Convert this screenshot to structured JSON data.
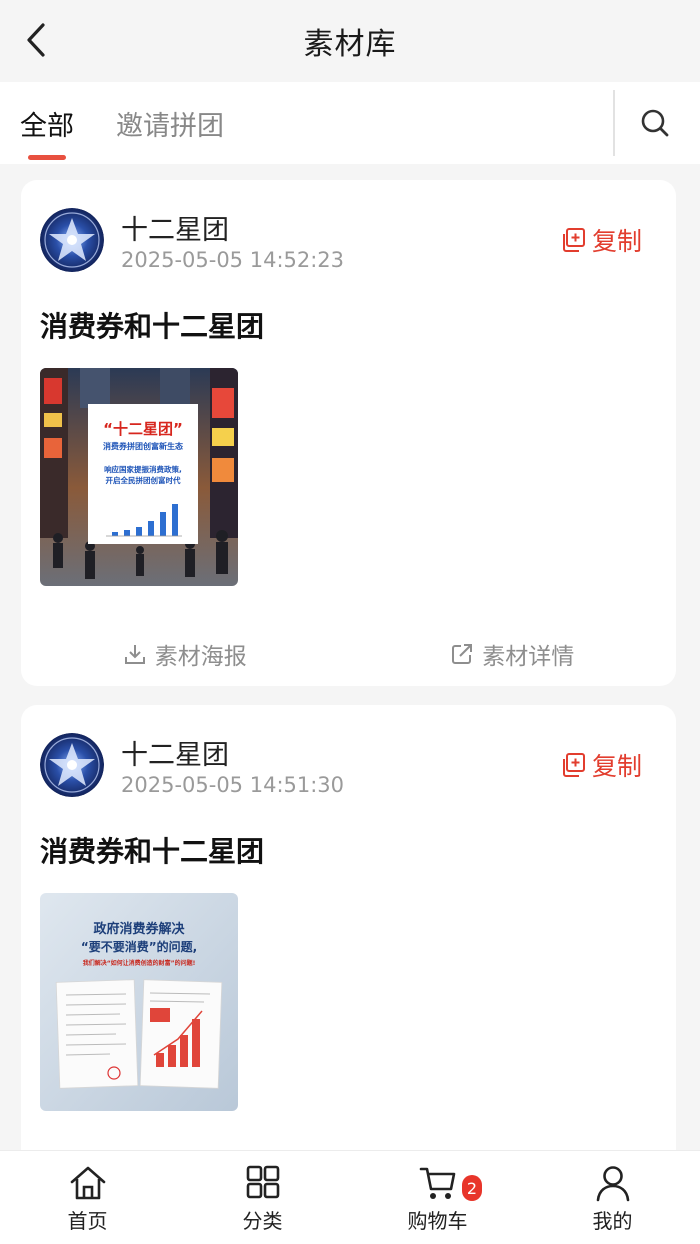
{
  "header": {
    "title": "素材库",
    "back_icon": "chevron-left-icon"
  },
  "tabs": [
    {
      "label": "全部",
      "active": true
    },
    {
      "label": "邀请拼团",
      "active": false
    }
  ],
  "search": {
    "icon": "search-icon"
  },
  "accent_color": "#e23d2e",
  "posts": [
    {
      "author": "十二星团",
      "timestamp": "2025-05-05 14:52:23",
      "copy_label": "复制",
      "title": "消费券和十二星团",
      "image": {
        "headline": "“十二星团”",
        "subhead": "消费券拼团创富新生态",
        "line1": "响应国家提振消费政策,",
        "line2": "开启全民拼团创富时代"
      },
      "poster_label": "素材海报",
      "detail_label": "素材详情"
    },
    {
      "author": "十二星团",
      "timestamp": "2025-05-05 14:51:30",
      "copy_label": "复制",
      "title": "消费券和十二星团",
      "image": {
        "line1": "政府消费券解决",
        "line2": "“要不要消费”的问题,",
        "line3": "我们解决“如何让消费创造的财富”的问题!"
      }
    }
  ],
  "bottom_nav": [
    {
      "label": "首页",
      "icon": "home-icon"
    },
    {
      "label": "分类",
      "icon": "grid-icon"
    },
    {
      "label": "购物车",
      "icon": "cart-icon",
      "badge": "2"
    },
    {
      "label": "我的",
      "icon": "user-icon"
    }
  ]
}
